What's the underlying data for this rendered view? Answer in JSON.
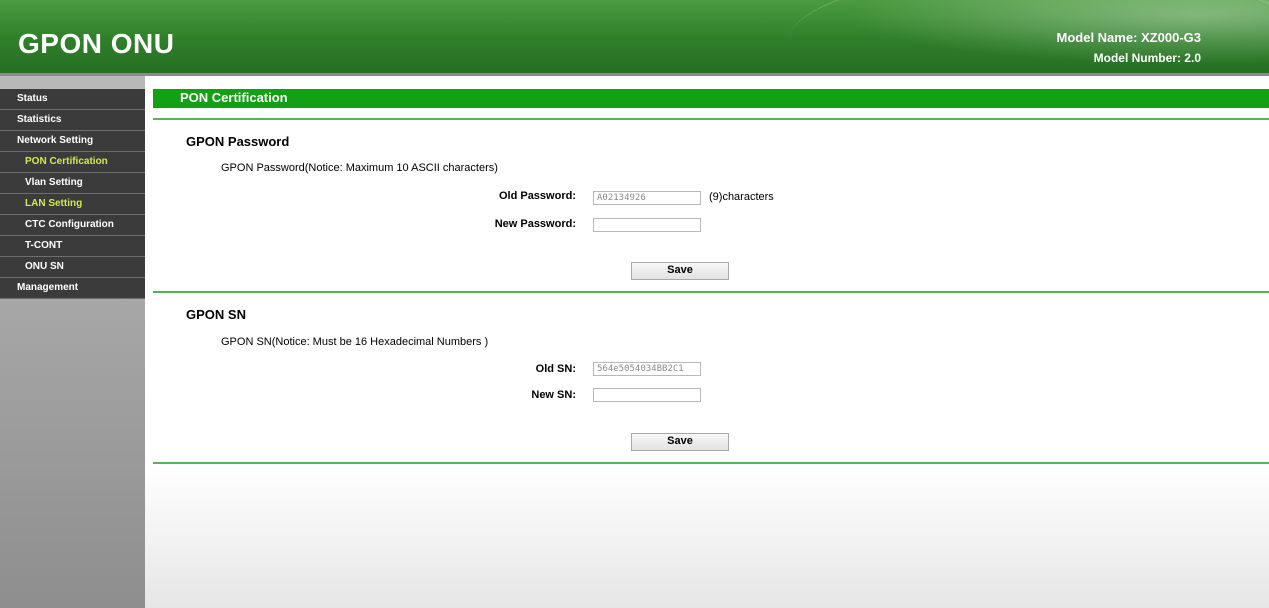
{
  "header": {
    "brand": "GPON ONU",
    "model_name": "Model Name: XZ000-G3",
    "model_number": "Model Number: 2.0"
  },
  "sidebar": {
    "items": [
      {
        "label": "Status"
      },
      {
        "label": "Statistics"
      },
      {
        "label": "Network Setting"
      },
      {
        "label": "PON Certification",
        "active": true
      },
      {
        "label": "Vlan Setting"
      },
      {
        "label": "LAN Setting"
      },
      {
        "label": "CTC Configuration"
      },
      {
        "label": "T-CONT"
      },
      {
        "label": "ONU SN"
      },
      {
        "label": "Management"
      }
    ]
  },
  "page": {
    "title": "PON Certification"
  },
  "password_section": {
    "title": "GPON Password",
    "notice": "GPON Password(Notice: Maximum 10 ASCII characters)",
    "old_label": "Old Password:",
    "old_value": "A02134926",
    "old_suffix": "(9)characters",
    "new_label": "New Password:",
    "new_value": "",
    "save_label": "Save"
  },
  "sn_section": {
    "title": "GPON SN",
    "notice": "GPON SN(Notice: Must be 16 Hexadecimal Numbers )",
    "old_label": "Old SN:",
    "old_value": "564e5054034BB2C1",
    "new_label": "New SN:",
    "new_value": "",
    "save_label": "Save"
  },
  "colors": {
    "header_green": "#2f7f2a",
    "title_bar_green": "#14a014",
    "active_nav": "#d4e84c",
    "nav_bg": "#3b3b3b"
  }
}
